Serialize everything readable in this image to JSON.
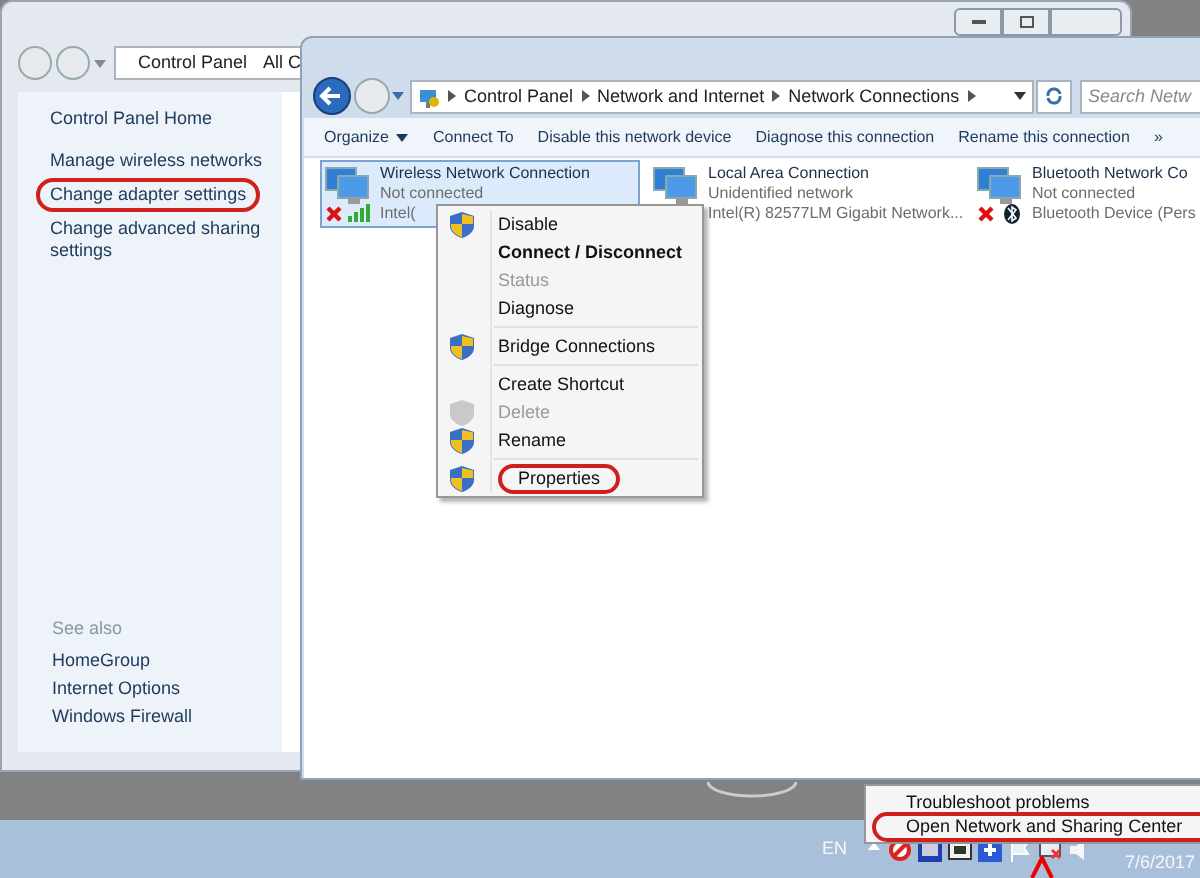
{
  "back_window": {
    "address": [
      "Control Panel",
      "All C"
    ],
    "sidebar": {
      "items": [
        {
          "label": "Control Panel Home",
          "circled": false
        },
        {
          "label": "Manage wireless networks",
          "circled": false
        },
        {
          "label": "Change adapter settings",
          "circled": true
        },
        {
          "label": "Change advanced sharing settings",
          "circled": false
        }
      ]
    },
    "see_also": {
      "title": "See also",
      "items": [
        "HomeGroup",
        "Internet Options",
        "Windows Firewall"
      ]
    }
  },
  "front_window": {
    "address": [
      "Control Panel",
      "Network and Internet",
      "Network Connections"
    ],
    "search": {
      "placeholder": "Search Netw"
    },
    "toolbar": [
      {
        "label": "Organize",
        "dropdown": true
      },
      {
        "label": "Connect To",
        "dropdown": false
      },
      {
        "label": "Disable this network device",
        "dropdown": false
      },
      {
        "label": "Diagnose this connection",
        "dropdown": false
      },
      {
        "label": "Rename this connection",
        "dropdown": false
      },
      {
        "label": "»",
        "dropdown": false
      }
    ],
    "connections": [
      {
        "name": "Wireless Network Connection",
        "status": "Not connected",
        "device": "Intel(",
        "kind": "wifi",
        "disconnected": true,
        "selected": true
      },
      {
        "name": "Local Area Connection",
        "status": "Unidentified network",
        "device": "Intel(R) 82577LM Gigabit Network...",
        "kind": "ethernet",
        "selected": false
      },
      {
        "name": "Bluetooth Network Co",
        "status": "Not connected",
        "device": "Bluetooth Device (Pers",
        "kind": "bluetooth",
        "disconnected": true,
        "selected": false
      }
    ]
  },
  "context_menu": {
    "items": [
      {
        "kind": "item",
        "label": "Disable",
        "shield": true,
        "bold": false,
        "disabled": false,
        "circled": false
      },
      {
        "kind": "item",
        "label": "Connect / Disconnect",
        "shield": false,
        "bold": true,
        "disabled": false,
        "circled": false
      },
      {
        "kind": "item",
        "label": "Status",
        "shield": false,
        "bold": false,
        "disabled": true,
        "circled": false
      },
      {
        "kind": "item",
        "label": "Diagnose",
        "shield": false,
        "bold": false,
        "disabled": false,
        "circled": false
      },
      {
        "kind": "separator"
      },
      {
        "kind": "item",
        "label": "Bridge Connections",
        "shield": true,
        "bold": false,
        "disabled": false,
        "circled": false
      },
      {
        "kind": "separator"
      },
      {
        "kind": "item",
        "label": "Create Shortcut",
        "shield": false,
        "bold": false,
        "disabled": false,
        "circled": false
      },
      {
        "kind": "item",
        "label": "Delete",
        "shield": true,
        "bold": false,
        "disabled": true,
        "circled": false
      },
      {
        "kind": "item",
        "label": "Rename",
        "shield": true,
        "bold": false,
        "disabled": false,
        "circled": false
      },
      {
        "kind": "separator"
      },
      {
        "kind": "item",
        "label": "Properties",
        "shield": true,
        "bold": false,
        "disabled": false,
        "circled": true
      }
    ]
  },
  "tray_menu": {
    "items": [
      {
        "label": "Troubleshoot problems",
        "circled": false
      },
      {
        "label": "Open Network and Sharing Center",
        "circled": true
      }
    ]
  },
  "taskbar": {
    "language": "EN",
    "date": "7/6/2017"
  }
}
